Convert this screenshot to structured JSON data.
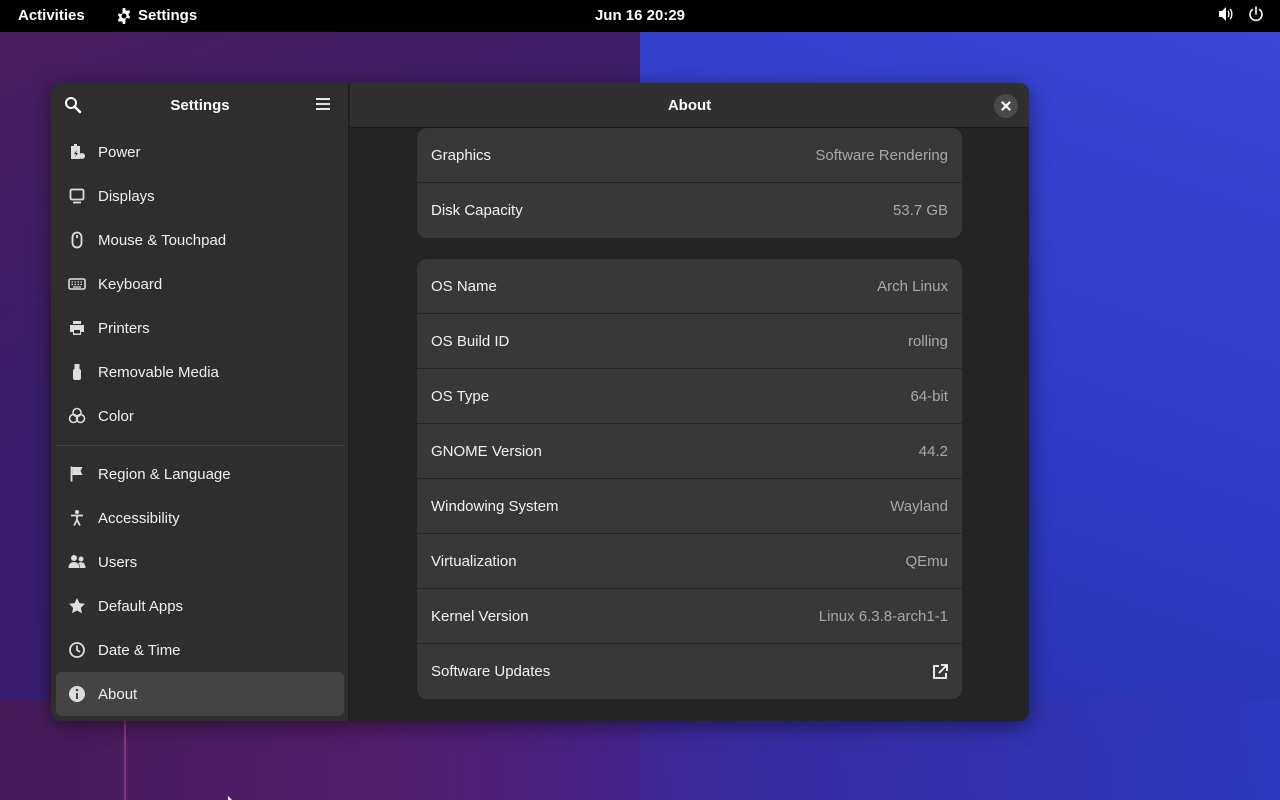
{
  "topbar": {
    "activities": "Activities",
    "app_name": "Settings",
    "clock": "Jun 16  20:29",
    "icons": [
      "gear-icon",
      "volume-icon",
      "power-icon"
    ]
  },
  "sidebar": {
    "title": "Settings",
    "items": [
      {
        "label": "Power",
        "icon": "power-battery-icon"
      },
      {
        "label": "Displays",
        "icon": "display-icon"
      },
      {
        "label": "Mouse & Touchpad",
        "icon": "mouse-icon"
      },
      {
        "label": "Keyboard",
        "icon": "keyboard-icon"
      },
      {
        "label": "Printers",
        "icon": "printer-icon"
      },
      {
        "label": "Removable Media",
        "icon": "usb-icon"
      },
      {
        "label": "Color",
        "icon": "color-icon"
      },
      {
        "label": "Region & Language",
        "icon": "flag-icon"
      },
      {
        "label": "Accessibility",
        "icon": "accessibility-icon"
      },
      {
        "label": "Users",
        "icon": "users-icon"
      },
      {
        "label": "Default Apps",
        "icon": "star-icon"
      },
      {
        "label": "Date & Time",
        "icon": "clock-icon"
      },
      {
        "label": "About",
        "icon": "info-icon"
      }
    ],
    "selected": "About"
  },
  "content": {
    "title": "About",
    "hardware": [
      {
        "label": "Graphics",
        "value": "Software Rendering"
      },
      {
        "label": "Disk Capacity",
        "value": "53.7 GB"
      }
    ],
    "software": [
      {
        "label": "OS Name",
        "value": "Arch Linux"
      },
      {
        "label": "OS Build ID",
        "value": "rolling"
      },
      {
        "label": "OS Type",
        "value": "64-bit"
      },
      {
        "label": "GNOME Version",
        "value": "44.2"
      },
      {
        "label": "Windowing System",
        "value": "Wayland"
      },
      {
        "label": "Virtualization",
        "value": "QEmu"
      },
      {
        "label": "Kernel Version",
        "value": "Linux 6.3.8-arch1-1"
      },
      {
        "label": "Software Updates",
        "value": ""
      }
    ]
  },
  "colors": {
    "accent": "#3584e4",
    "window_bg": "#242424",
    "sidebar_bg": "#2e2e2e",
    "card_bg": "#383838"
  }
}
